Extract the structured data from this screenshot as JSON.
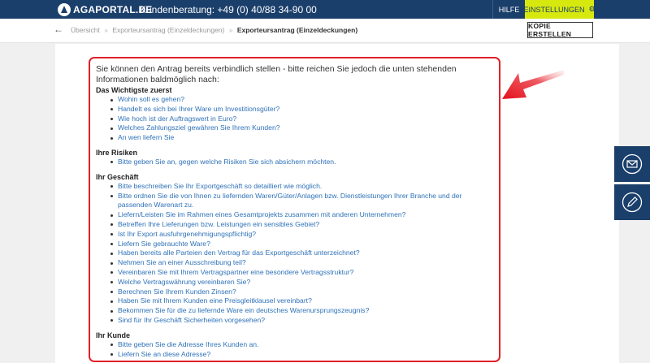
{
  "header": {
    "logo": "AGAPORTAL.DE",
    "hotline": "Kundenberatung: +49 (0) 40/88 34-90 00",
    "help": "HILFE",
    "settings": "EINSTELLUNGEN"
  },
  "breadcrumb": {
    "items": [
      "Übersicht",
      "Exporteursantrag (Einzeldeckungen)"
    ],
    "separator": "»",
    "current": "Exporteursantrag (Einzeldeckungen)"
  },
  "copy_button": "KOPIE ERSTELLEN",
  "intro": "Sie können den Antrag bereits verbindlich stellen - bitte reichen Sie jedoch die unten stehenden Informationen baldmöglich nach:",
  "sections": [
    {
      "title": "Das Wichtigste zuerst",
      "items": [
        "Wohin soll es gehen?",
        "Handelt es sich bei Ihrer Ware um Investitionsgüter?",
        "Wie hoch ist der Auftragswert in Euro?",
        "Welches Zahlungsziel gewähren Sie Ihrem Kunden?",
        "An wen liefern Sie"
      ]
    },
    {
      "title": "Ihre Risiken",
      "items": [
        "Bitte geben Sie an, gegen welche Risiken Sie sich absichern möchten."
      ]
    },
    {
      "title": "Ihr Geschäft",
      "items": [
        "Bitte beschreiben Sie Ihr Exportgeschäft so detailliert wie möglich.",
        "Bitte ordnen Sie die von Ihnen zu liefernden Waren/Güter/Anlagen bzw. Dienstleistungen Ihrer Branche und der passenden Warenart zu.",
        "Liefern/Leisten Sie im Rahmen eines Gesamtprojekts zusammen mit anderen Unternehmen?",
        "Betreffen Ihre Lieferungen bzw. Leistungen ein sensibles Gebiet?",
        "Ist Ihr Export ausfuhrgenehmigungspflichtig?",
        "Liefern Sie gebrauchte Ware?",
        "Haben bereits alle Parteien den Vertrag für das Exportgeschäft unterzeichnet?",
        "Nehmen Sie an einer Ausschreibung teil?",
        "Vereinbaren Sie mit Ihrem Vertragspartner eine besondere Vertragsstruktur?",
        "Welche Vertragswährung vereinbaren Sie?",
        "Berechnen Sie Ihrem Kunden Zinsen?",
        "Haben Sie mit Ihrem Kunden eine Preisgleitklausel vereinbart?",
        "Bekommen Sie für die zu liefernde Ware ein deutsches Warenursprungszeugnis?",
        "Sind für Ihr Geschäft Sicherheiten vorgesehen?"
      ]
    },
    {
      "title": "Ihr Kunde",
      "items": [
        "Bitte geben Sie die Adresse Ihres Kunden an.",
        "Liefern Sie an diese Adresse?"
      ]
    }
  ],
  "colors": {
    "nav_bg": "#1b3f6b",
    "settings_bg": "#d7e80f",
    "link": "#2f72b8",
    "highlight": "#e0202a"
  }
}
